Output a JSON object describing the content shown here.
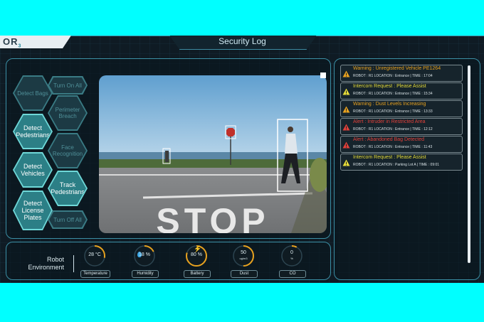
{
  "header": {
    "logo": "OR",
    "logo_sub": "3",
    "title": "Security Log"
  },
  "controls": {
    "detect_bags": "Detect Bags",
    "turn_on_all": "Turn On All",
    "perimeter_breach": "Perimeter Breach",
    "detect_pedestrians": "Detect Pedestrians",
    "face_recognition": "Face Recognition",
    "detect_vehicles": "Detect Vehicles",
    "track_pedestrians": "Track Pedestrians",
    "detect_license_plates": "Detect License Plates",
    "turn_off_all": "Turn Off All"
  },
  "video": {
    "road_text": "STOP"
  },
  "log": [
    {
      "title": "Warning : Unregistered Vehicle PE1264",
      "meta": "ROBOT : R1 LOCATION : Entrance | TIME : 17:04",
      "type": "warning",
      "color": "#e8a21f"
    },
    {
      "title": "Intercom Request : Please Assist",
      "meta": "ROBOT : R1 LOCATION : Entrance | TIME : 15:34",
      "type": "intercom",
      "color": "#e6dc3a"
    },
    {
      "title": "Warning : Dust Levels Increasing",
      "meta": "ROBOT : R1 LOCATION : Entrance | TIME : 13:33",
      "type": "warning",
      "color": "#e8a21f"
    },
    {
      "title": "Alert : Intruder in Restricted Area",
      "meta": "ROBOT : R1 LOCATION : Entrance | TIME : 12:12",
      "type": "alert",
      "color": "#e0403a"
    },
    {
      "title": "Alert : Abandoned Bag Detected",
      "meta": "ROBOT : R1 LOCATION : Entrance | TIME : 11:43",
      "type": "alert",
      "color": "#e0403a"
    },
    {
      "title": "Intercom Request : Please Assist",
      "meta": "ROBOT : R1 LOCATION : Parking Lot A | TIME : 09:01",
      "type": "intercom",
      "color": "#e6dc3a"
    }
  ],
  "environment": {
    "label_line1": "Robot",
    "label_line2": "Environment",
    "gauges": [
      {
        "value": "28 °C",
        "label": "Temperature",
        "level": 0.28,
        "color": "#e8a21f"
      },
      {
        "value": "18 %",
        "label": "Humidity",
        "level": 0.18,
        "color": "#e8a21f"
      },
      {
        "value": "80 %",
        "label": "Battery",
        "level": 0.8,
        "color": "#e8a21f"
      },
      {
        "value": "50",
        "unit": "ug/m3",
        "label": "Dust",
        "level": 0.5,
        "color": "#e8a21f"
      },
      {
        "value": "0",
        "unit": "%",
        "label": "CO",
        "level": 0.08,
        "color": "#e8a21f"
      }
    ]
  }
}
